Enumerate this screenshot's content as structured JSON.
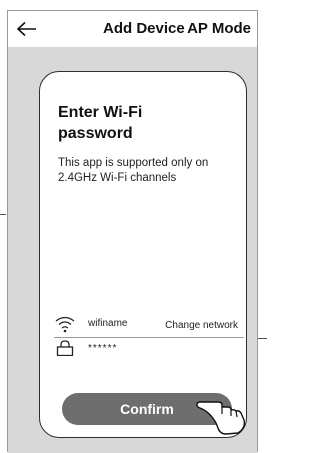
{
  "header": {
    "back_icon": "arrow-left-icon",
    "title": "Add Device",
    "mode_tab": "AP Mode"
  },
  "card": {
    "title": "Enter Wi-Fi password",
    "description": "This app is supported only on 2.4GHz Wi-Fi channels",
    "wifi": {
      "icon": "wifi-icon",
      "ssid": "wifiname",
      "change_label": "Change network"
    },
    "password": {
      "icon": "lock-icon",
      "value": "******"
    },
    "confirm_label": "Confirm"
  },
  "colors": {
    "content_bg": "#d8d8d8",
    "card_bg": "#ffffff",
    "confirm_bg": "#6e6e6e",
    "confirm_text": "#ffffff"
  }
}
